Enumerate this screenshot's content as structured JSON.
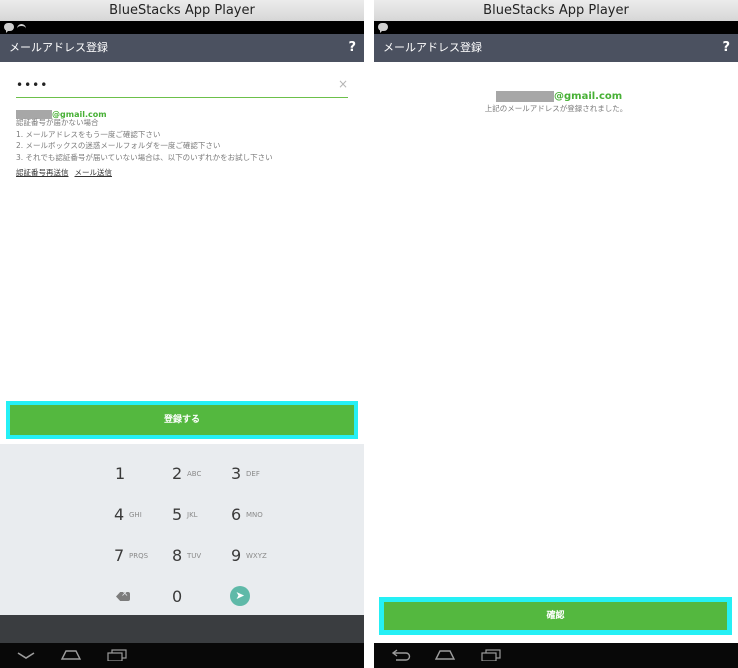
{
  "window_title": "BlueStacks App Player",
  "appbar": {
    "title": "メールアドレス登録",
    "help": "?"
  },
  "left_screen": {
    "pin_value": "••••",
    "clear_icon": "×",
    "email_domain": "@gmail.com",
    "help_lines": [
      "認証番号が届かない場合",
      "1. メールアドレスをもう一度ご確認下さい",
      "2. メールボックスの迷惑メールフォルダを一度ご確認下さい",
      "3. それでも認証番号が届いていない場合は、以下のいずれかをお試し下さい"
    ],
    "links": [
      "認証番号再送信",
      "メール送信"
    ],
    "register_button": "登録する"
  },
  "keypad": {
    "keys": [
      {
        "num": "1",
        "letters": ""
      },
      {
        "num": "2",
        "letters": "ABC"
      },
      {
        "num": "3",
        "letters": "DEF"
      },
      {
        "num": "4",
        "letters": "GHI"
      },
      {
        "num": "5",
        "letters": "JKL"
      },
      {
        "num": "6",
        "letters": "MNO"
      },
      {
        "num": "7",
        "letters": "PRQS"
      },
      {
        "num": "8",
        "letters": "TUV"
      },
      {
        "num": "9",
        "letters": "WXYZ"
      }
    ],
    "zero": "0",
    "backspace_icon": "backspace-icon",
    "go_icon": "arrow-send-icon"
  },
  "right_screen": {
    "email_domain": "@gmail.com",
    "message": "上記のメールアドレスが登録されました。",
    "confirm_button": "確認"
  },
  "colors": {
    "accent_green": "#54b83f",
    "highlight_cyan": "#25f0f5",
    "appbar_bg": "#4b5160",
    "email_green": "#47b035"
  }
}
